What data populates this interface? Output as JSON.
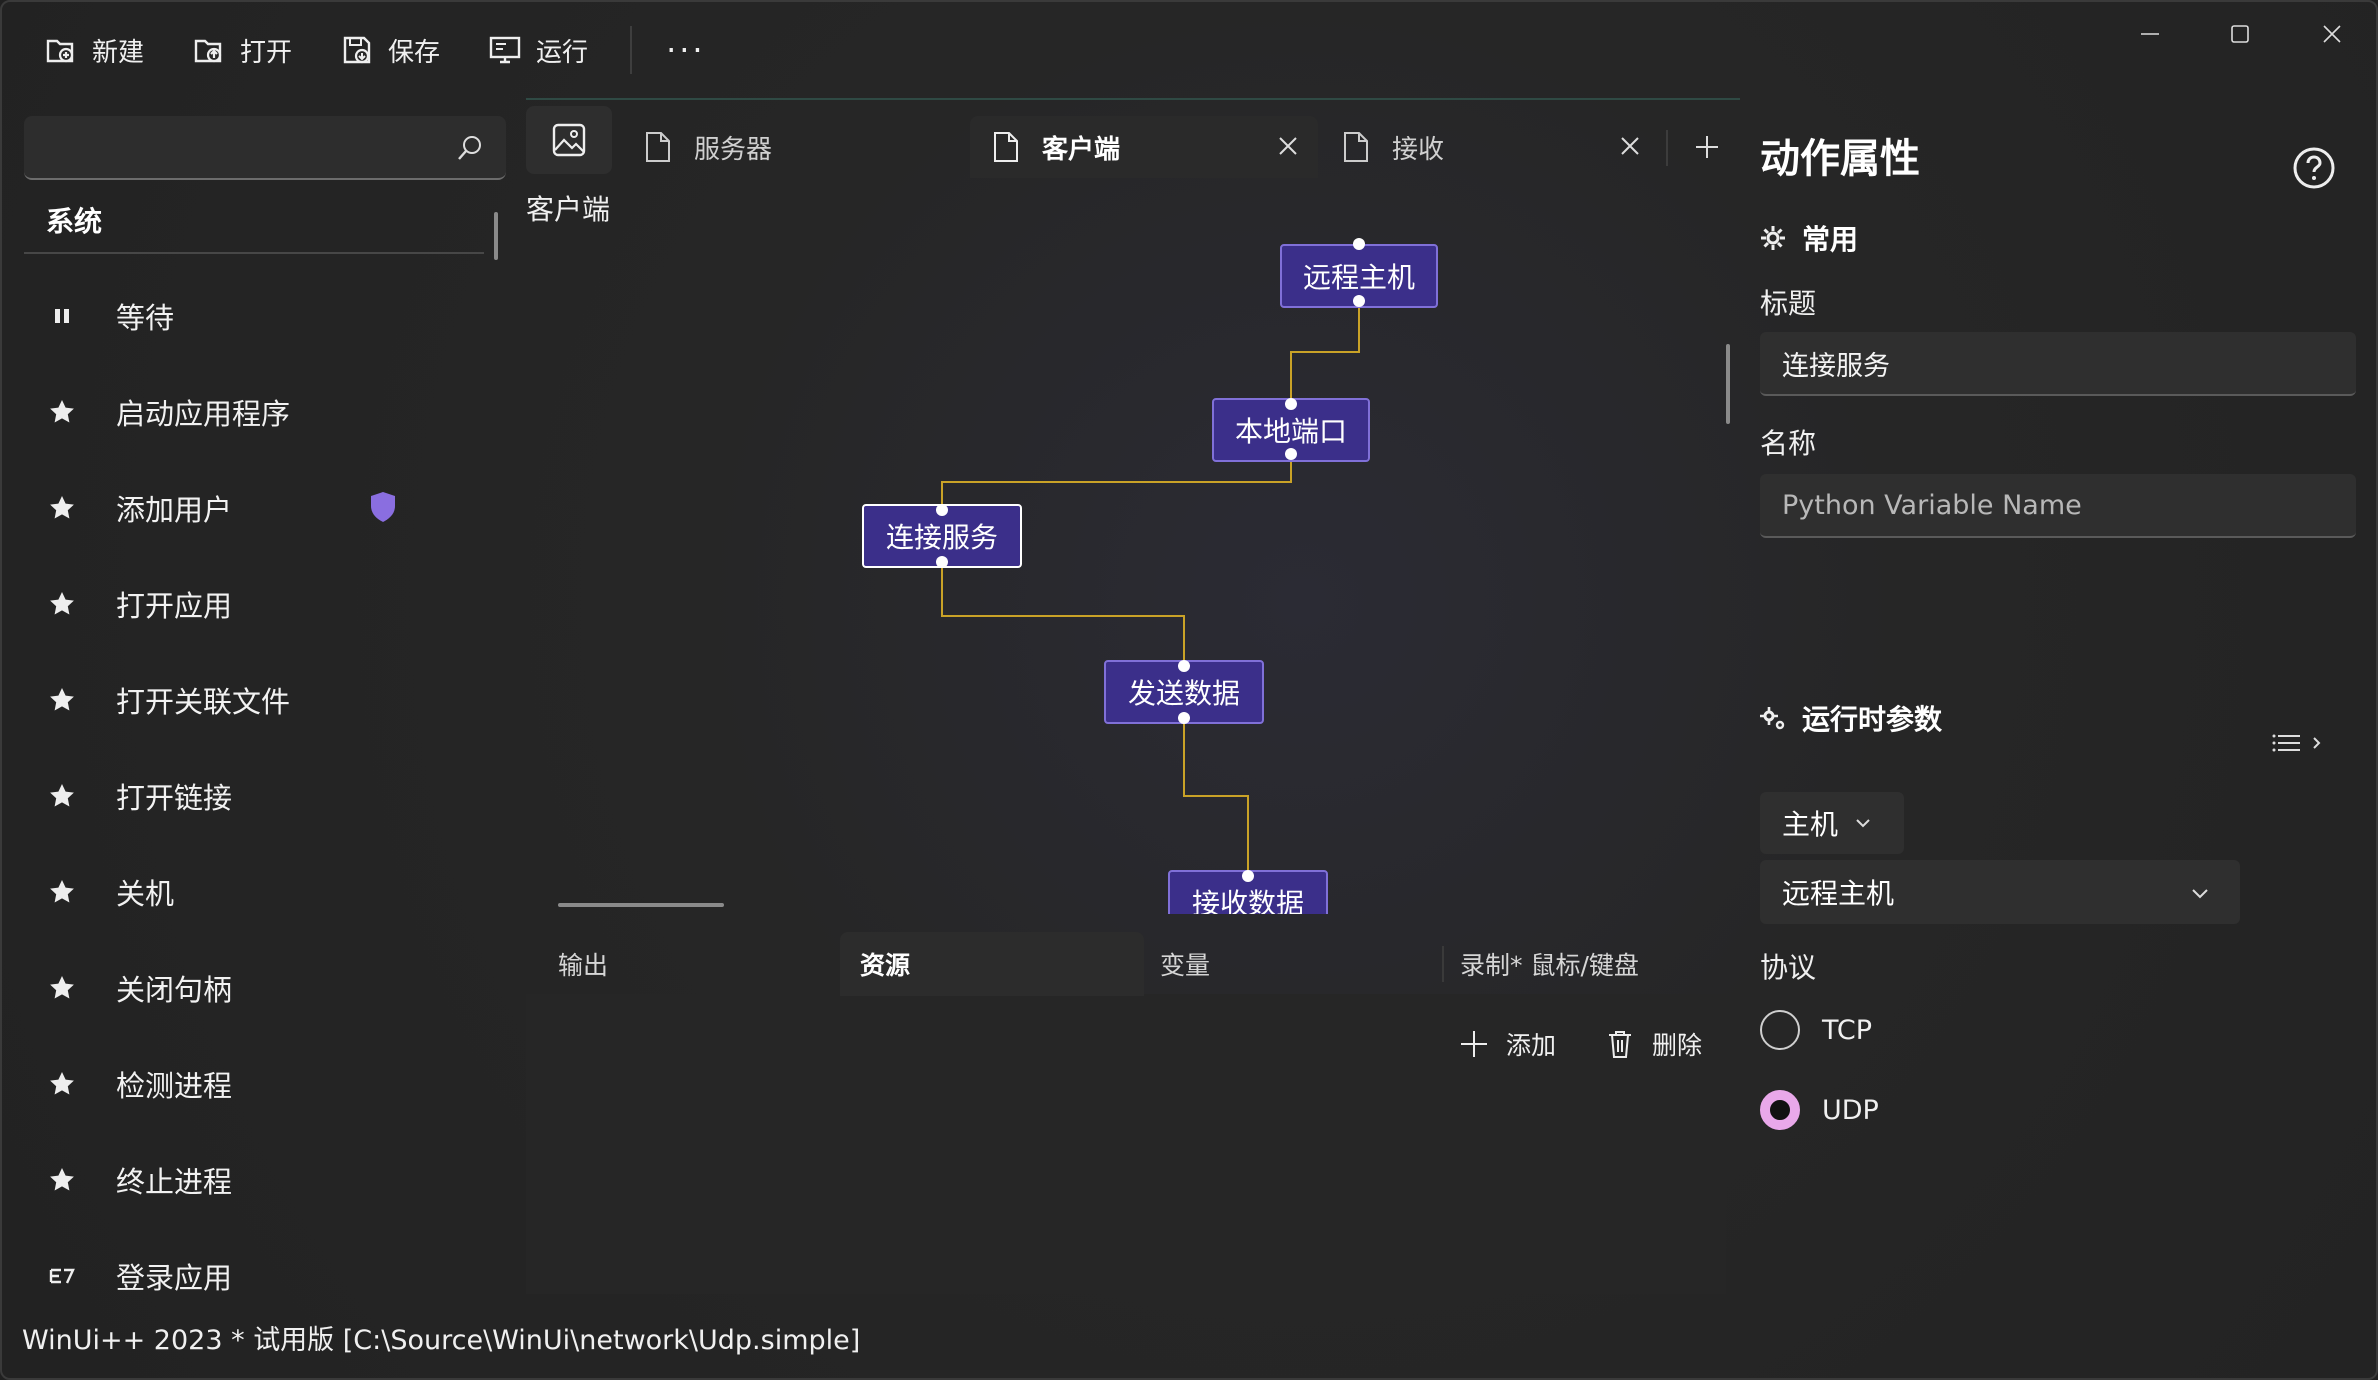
{
  "toolbar": {
    "new_label": "新建",
    "open_label": "打开",
    "save_label": "保存",
    "run_label": "运行",
    "more_label": "···"
  },
  "sidebar": {
    "search_placeholder": "",
    "category": "系统",
    "items": [
      {
        "label": "等待",
        "icon": "pause-icon"
      },
      {
        "label": "启动应用程序",
        "icon": "star-icon"
      },
      {
        "label": "添加用户",
        "icon": "star-icon",
        "badge": "shield-icon"
      },
      {
        "label": "打开应用",
        "icon": "star-icon"
      },
      {
        "label": "打开关联文件",
        "icon": "star-icon"
      },
      {
        "label": "打开链接",
        "icon": "star-icon"
      },
      {
        "label": "关机",
        "icon": "star-icon"
      },
      {
        "label": "关闭句柄",
        "icon": "star-icon"
      },
      {
        "label": "检测进程",
        "icon": "star-icon"
      },
      {
        "label": "终止进程",
        "icon": "star-icon"
      },
      {
        "label": "登录应用",
        "icon": "login-icon"
      }
    ]
  },
  "tabs": [
    {
      "label": "服务器",
      "active": false,
      "closable": false
    },
    {
      "label": "客户端",
      "active": true,
      "closable": true
    },
    {
      "label": "接收",
      "active": false,
      "closable": true
    }
  ],
  "document": {
    "title": "客户端",
    "nodes": [
      {
        "label": "远程主机"
      },
      {
        "label": "本地端口"
      },
      {
        "label": "连接服务",
        "selected": true
      },
      {
        "label": "发送数据"
      },
      {
        "label": "接收数据"
      }
    ]
  },
  "bottom_panel": {
    "tabs": [
      "输出",
      "资源",
      "变量",
      "录制* 鼠标/键盘"
    ],
    "active_tab": "资源",
    "add_label": "添加",
    "delete_label": "删除"
  },
  "properties": {
    "title": "动作属性",
    "common_section": "常用",
    "title_label": "标题",
    "title_value": "连接服务",
    "name_label": "名称",
    "name_placeholder": "Python Variable Name",
    "runtime_section": "运行时参数",
    "host_type": "主机",
    "host_value": "远程主机",
    "protocol_label": "协议",
    "protocol_options": [
      "TCP",
      "UDP"
    ],
    "protocol_selected": "UDP"
  },
  "status_bar": {
    "text": "WinUi++ 2023 * 试用版 [C:\\Source\\WinUi\\network\\Udp.simple]"
  },
  "colors": {
    "node_fill": "#3b2f8a",
    "node_border": "#8070d8",
    "connector": "#c9a227",
    "radio_accent": "#e9a8ea",
    "shield_badge": "#8a6ee0"
  }
}
